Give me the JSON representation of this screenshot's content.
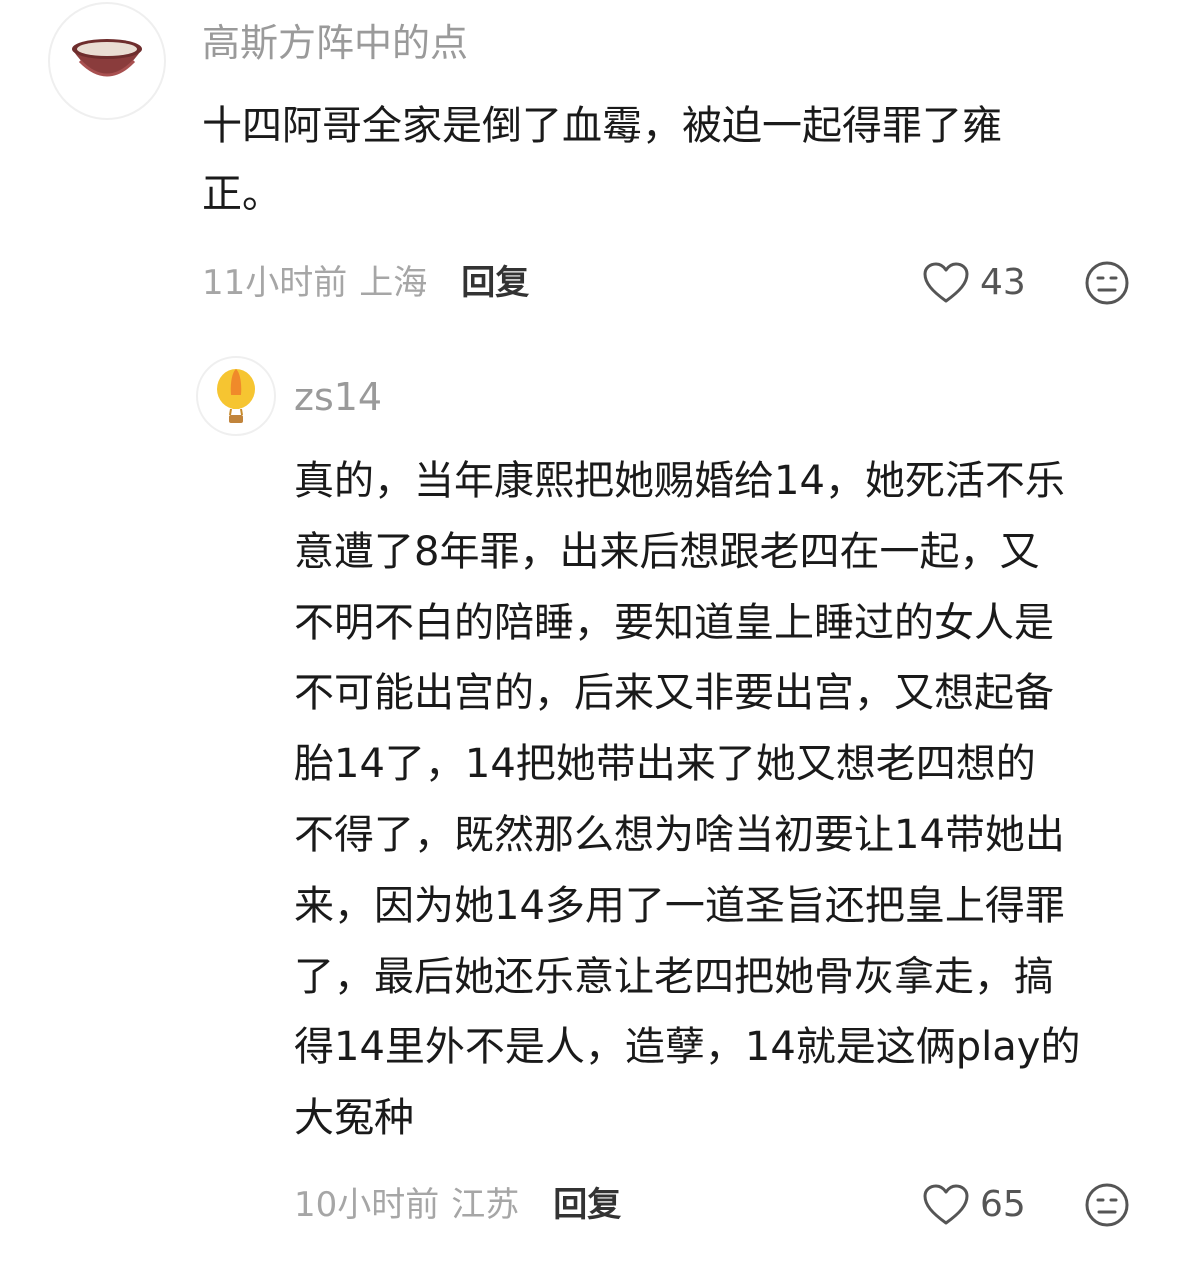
{
  "comments": [
    {
      "username": "高斯方阵中的点",
      "avatar_icon": "bowl-icon",
      "text": "十四阿哥全家是倒了血霉，被迫一起得罪了雍\n正。",
      "time": "11小时前",
      "location": "上海",
      "reply_label": "回复",
      "likes": "43"
    },
    {
      "username": "zs14",
      "avatar_icon": "hot-air-balloon-icon",
      "text": "真的，当年康熙把她赐婚给14，她死活不乐\n意遭了8年罪，出来后想跟老四在一起，又\n不明不白的陪睡，要知道皇上睡过的女人是\n不可能出宫的，后来又非要出宫，又想起备\n胎14了，14把她带出来了她又想老四想的\n不得了，既然那么想为啥当初要让14带她出\n来，因为她14多用了一道圣旨还把皇上得罪\n了，最后她还乐意让老四把她骨灰拿走，搞\n得14里外不是人，造孽，14就是这俩play的\n大冤种",
      "time": "10小时前",
      "location": "江苏",
      "reply_label": "回复",
      "likes": "65"
    }
  ]
}
